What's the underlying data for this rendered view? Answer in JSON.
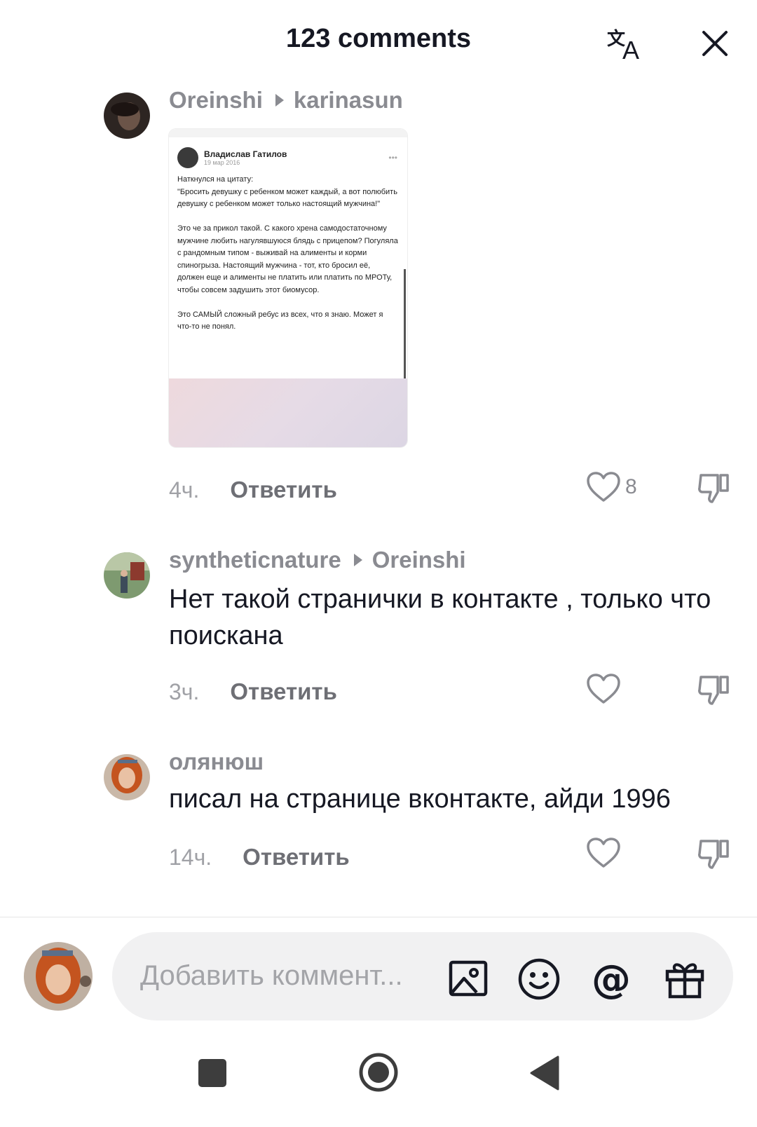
{
  "header": {
    "title": "123 comments"
  },
  "comments": [
    {
      "author": "Oreinshi",
      "reply_to": "karinasun",
      "time": "4ч.",
      "reply_label": "Ответить",
      "likes": "8",
      "attached_post": {
        "name": "Владислав Гатилов",
        "date": "19 мар 2016",
        "dots": "•••",
        "text": "Наткнулся на цитату:\n\"Бросить девушку с ребенком может каждый, а вот полюбить девушку с ребенком может только настоящий мужчина!\"\n\nЭто че за прикол такой. С какого хрена самодостаточному мужчине любить нагулявшуюся блядь с прицепом? Погуляла с рандомным типом - выживай на алименты и корми спиногрыза. Настоящий мужчина - тот, кто бросил её, должен еще и алименты не платить или платить по МРОТу, чтобы совсем задушить этот биомусор.\n\nЭто САМЫЙ сложный ребус из всех, что я знаю. Может я что-то не понял."
      }
    },
    {
      "author": "syntheticnature",
      "reply_to": "Oreinshi",
      "text": "Нет такой странички в контакте , только что поискана",
      "time": "3ч.",
      "reply_label": "Ответить"
    },
    {
      "author": "олянюш",
      "text": "писал на странице вконтакте, айди 1996",
      "time": "14ч.",
      "reply_label": "Ответить"
    }
  ],
  "composer": {
    "placeholder": "Добавить коммент..."
  }
}
